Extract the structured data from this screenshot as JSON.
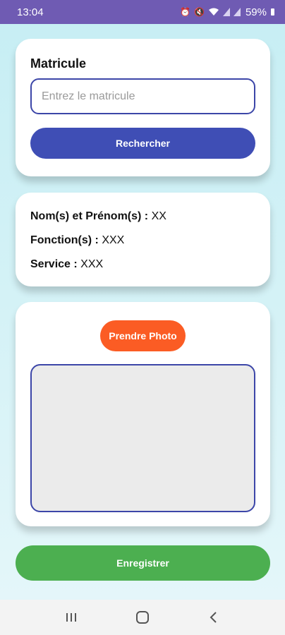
{
  "status_bar": {
    "time": "13:04",
    "icons": [
      "alarm-icon",
      "mute-icon",
      "wifi-icon",
      "signal-icon",
      "signal-icon"
    ],
    "battery": "59%"
  },
  "search_card": {
    "title": "Matricule",
    "input_placeholder": "Entrez le matricule",
    "input_value": "",
    "search_button": "Rechercher"
  },
  "info_card": {
    "name_label": "Nom(s) et Prénom(s) :",
    "name_value": "XX",
    "function_label": "Fonction(s) :",
    "function_value": "XXX",
    "service_label": "Service :",
    "service_value": "XXX"
  },
  "photo_card": {
    "photo_button": "Prendre Photo"
  },
  "save_button": "Enregistrer",
  "nav_bar": {
    "items": [
      "recent-apps-icon",
      "home-icon",
      "back-icon"
    ]
  },
  "colors": {
    "status_bar": "#6f5bb3",
    "primary": "#3f4eb5",
    "photo_button": "#fb5c24",
    "save_button": "#4caf50",
    "border": "#3c46a8"
  }
}
